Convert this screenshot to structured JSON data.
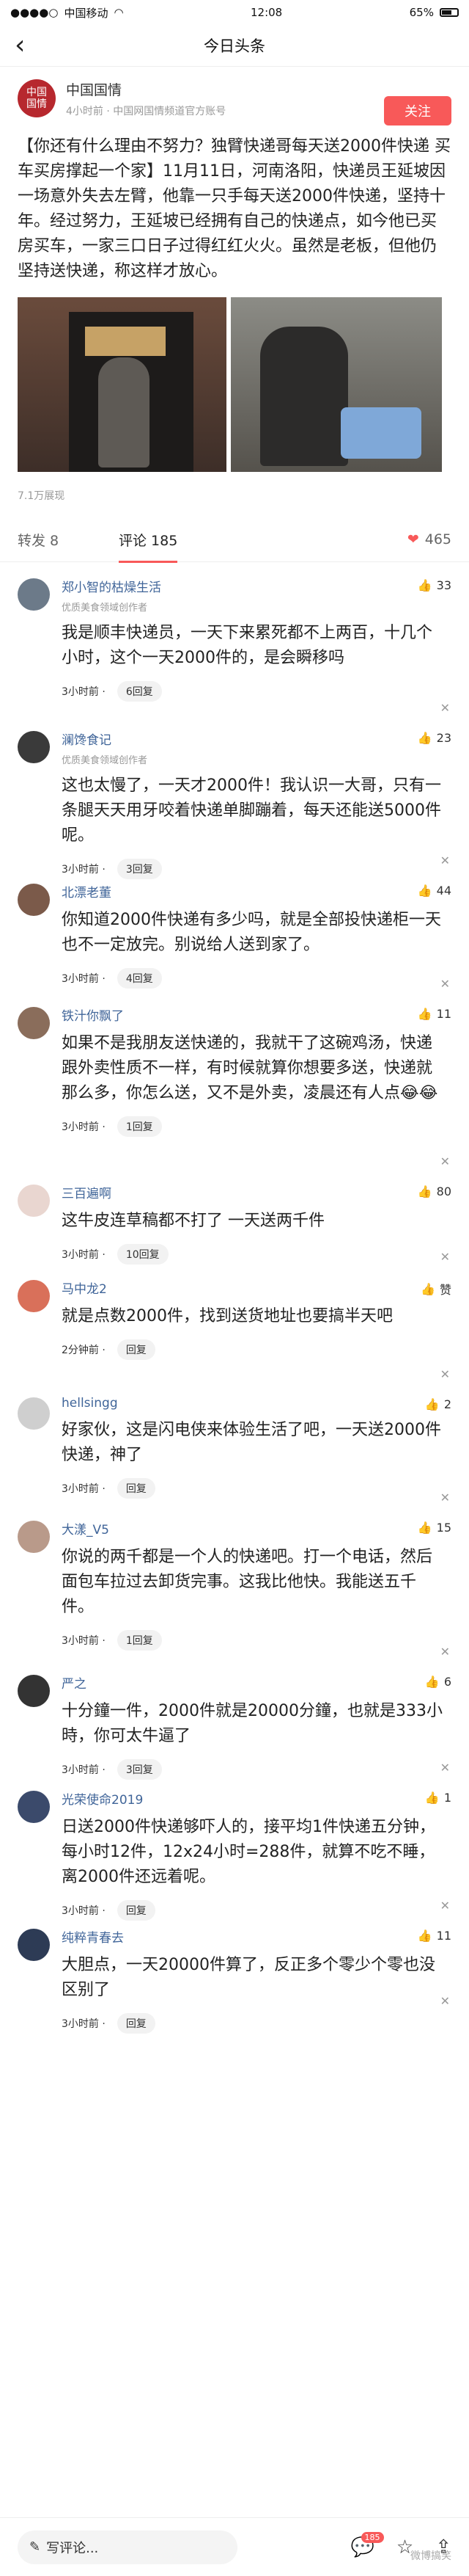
{
  "status": {
    "carrier": "中国移动",
    "time": "12:08",
    "battery": "65%"
  },
  "nav": {
    "title": "今日头条",
    "back": "‹"
  },
  "author": {
    "avatar_text": "中国\n国情",
    "name": "中国国情",
    "subtitle": "4小时前 · 中国网国情频道官方账号",
    "follow": "关注"
  },
  "post": {
    "text": "【你还有什么理由不努力？独臂快递哥每天送2000件快递 买车买房撑起一个家】11月11日，河南洛阳，快递员王延坡因一场意外失去左臂，他靠一只手每天送2000件快递，坚持十年。经过努力，王延坡已经拥有自己的快递点，如今他已买房买车，一家三口日子过得红红火火。虽然是老板，但他仍坚持送快递，称这样才放心。",
    "views": "7.1万展现"
  },
  "tabs": {
    "share": "转发 8",
    "comments": "评论 185",
    "likes": "465"
  },
  "comments": [
    {
      "name": "郑小智的枯燥生活",
      "sub": "优质美食领域创作者",
      "likes": "33",
      "text": "我是顺丰快递员，一天下来累死都不上两百，十几个小时，这个一天2000件的，是会瞬移吗",
      "time": "3小时前 ·",
      "reply": "6回复",
      "avatar_color": "#6c7a89"
    },
    {
      "name": "澜馋食记",
      "sub": "优质美食领域创作者",
      "likes": "23",
      "text": "这也太慢了，一天才2000件！我认识一大哥，只有一条腿天天用牙咬着快递单脚蹦着，每天还能送5000件呢。",
      "time": "3小时前 ·",
      "reply": "3回复",
      "avatar_color": "#3a3a3a"
    },
    {
      "name": "北漂老董",
      "sub": "",
      "likes": "44",
      "text": "你知道2000件快递有多少吗，就是全部投快递柜一天也不一定放完。别说给人送到家了。",
      "time": "3小时前 ·",
      "reply": "4回复",
      "avatar_color": "#7b5a4a"
    },
    {
      "name": "铁汁你飘了",
      "sub": "",
      "likes": "11",
      "text": "如果不是我朋友送快递的，我就干了这碗鸡汤，快递跟外卖性质不一样，有时候就算你想要多送，快递就那么多，你怎么送，又不是外卖，凌晨还有人点😂😂",
      "time": "3小时前 ·",
      "reply": "1回复",
      "avatar_color": "#8a6d5b"
    },
    {
      "name": "三百遍啊",
      "sub": "",
      "likes": "80",
      "text": "这牛皮连草稿都不打了 一天送两千件",
      "time": "3小时前 ·",
      "reply": "10回复",
      "avatar_color": "#e9d6d0"
    },
    {
      "name": "马中龙2",
      "sub": "",
      "likes": "赞",
      "text": "就是点数2000件，找到送货地址也要搞半天吧",
      "time": "2分钟前 ·",
      "reply": "回复",
      "avatar_color": "#d9705a"
    },
    {
      "name": "hellsingg",
      "sub": "",
      "likes": "2",
      "text": "好家伙，这是闪电侠来体验生活了吧，一天送2000件快递，神了",
      "time": "3小时前 ·",
      "reply": "回复",
      "avatar_color": "#cfcfcf"
    },
    {
      "name": "大漾_V5",
      "sub": "",
      "likes": "15",
      "text": "你说的两千都是一个人的快递吧。打一个电话，然后面包车拉过去卸货完事。这我比他快。我能送五千件。",
      "time": "3小时前 ·",
      "reply": "1回复",
      "avatar_color": "#b99a8a"
    },
    {
      "name": "严之",
      "sub": "",
      "likes": "6",
      "text": "十分鐘一件，2000件就是20000分鐘，也就是333小時，你可太牛逼了",
      "time": "3小时前 ·",
      "reply": "3回复",
      "avatar_color": "#333333"
    },
    {
      "name": "光荣使命2019",
      "sub": "",
      "likes": "1",
      "text": "日送2000件快递够吓人的，接平均1件快递五分钟，每小时12件，12x24小时=288件，就算不吃不睡，离2000件还远着呢。",
      "time": "3小时前 ·",
      "reply": "回复",
      "avatar_color": "#3b4a6b"
    },
    {
      "name": "纯粹青春去",
      "sub": "",
      "likes": "11",
      "text": "大胆点，一天20000件算了，反正多个零少个零也没区别了",
      "time": "3小时前 ·",
      "reply": "回复",
      "avatar_color": "#2d3b55"
    }
  ],
  "bottom": {
    "placeholder": "写评论...",
    "badge": "185",
    "watermark": "微博搞笑"
  },
  "icons": {
    "back": "chevron-left-icon",
    "like": "thumb-up-icon",
    "comment": "chat-icon",
    "star": "star-icon",
    "share": "share-icon"
  }
}
